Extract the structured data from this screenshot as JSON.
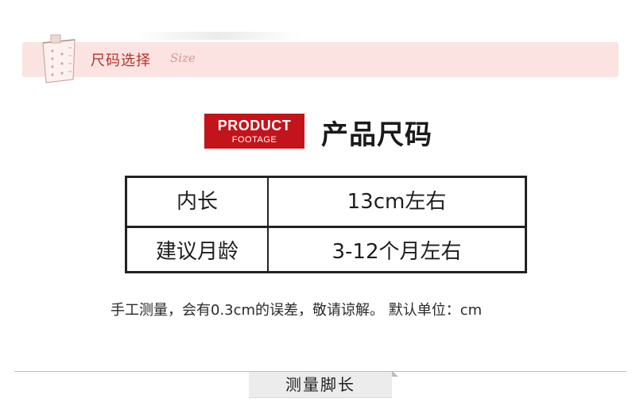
{
  "header": {
    "title": "尺码选择",
    "script_text": "Size"
  },
  "section": {
    "badge_top": "PRODUCT",
    "badge_bottom": "FOOTAGE",
    "title": "产品尺码"
  },
  "size_table": {
    "rows": [
      {
        "label": "内长",
        "value": "13cm左右"
      },
      {
        "label": "建议月龄",
        "value": "3-12个月左右"
      }
    ]
  },
  "note": "手工测量，会有0.3cm的误差，敬请谅解。 默认单位：cm",
  "next_section": {
    "tab_label": "测量脚长"
  },
  "colors": {
    "banner_bg": "#fbe3e1",
    "accent_red": "#c3141b",
    "banner_text": "#b3332b"
  },
  "icons": {
    "header_icon": "measuring-tape-icon"
  }
}
